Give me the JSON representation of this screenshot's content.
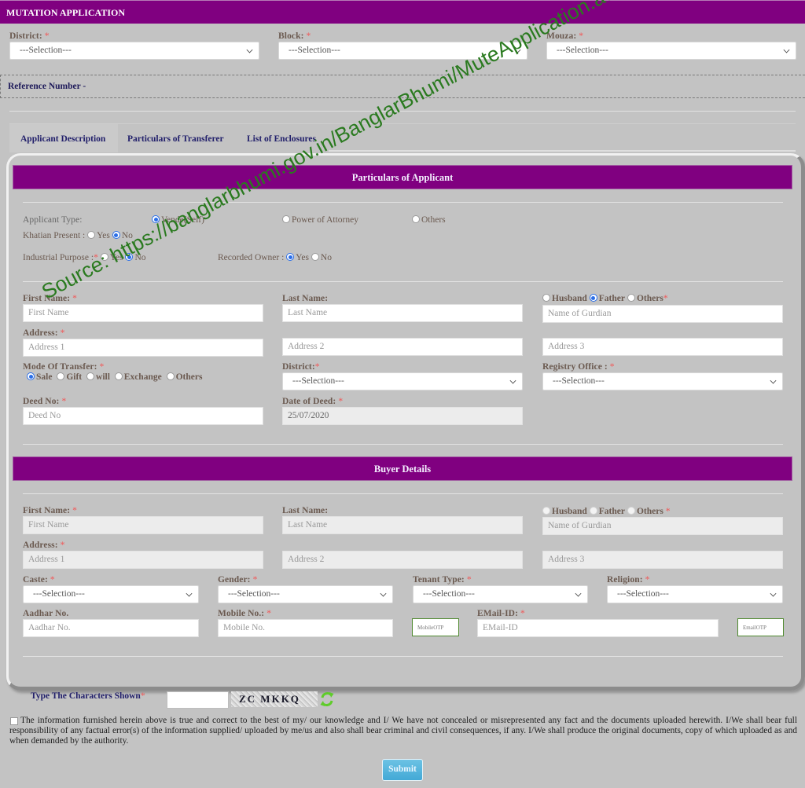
{
  "header": {
    "title": "MUTATION APPLICATION"
  },
  "location": {
    "district": {
      "label": "District:",
      "value": "---Selection---"
    },
    "block": {
      "label": "Block:",
      "value": "---Selection---"
    },
    "mouza": {
      "label": "Mouza:",
      "value": "---Selection---"
    }
  },
  "reference": {
    "label": "Reference Number -"
  },
  "tabs": [
    {
      "label": "Applicant Description",
      "active": true
    },
    {
      "label": "Particulars of Transferer",
      "active": false
    },
    {
      "label": "List of Enclosures",
      "active": false
    }
  ],
  "applicant": {
    "section_title": "Particulars of Applicant",
    "applicant_type": {
      "label": "Applicant Type:",
      "options": [
        "Vende(Self)",
        "Power of Attorney",
        "Others"
      ],
      "selected": "Vende(Self)"
    },
    "khatian_present": {
      "label": "Khatian Present :",
      "options": [
        "Yes",
        "No"
      ],
      "selected": "No"
    },
    "industrial_purpose": {
      "label": "Industrial Purpose :",
      "options": [
        "Yes",
        "No"
      ],
      "selected": "No"
    },
    "recorded_owner": {
      "label": "Recorded Owner :",
      "options": [
        "Yes",
        "No"
      ],
      "selected": "Yes"
    },
    "first_name": {
      "label": "First Name:",
      "placeholder": "First Name"
    },
    "last_name": {
      "label": "Last Name:",
      "placeholder": "Last Name"
    },
    "guardian_relation": {
      "options": [
        "Husband",
        "Father",
        "Others"
      ],
      "selected": "Father"
    },
    "guardian_name": {
      "placeholder": "Name of Gurdian"
    },
    "address": {
      "label": "Address:",
      "placeholders": [
        "Address 1",
        "Address 2",
        "Address 3"
      ]
    },
    "mode_of_transfer": {
      "label": "Mode Of Transfer:",
      "options": [
        "Sale",
        "Gift",
        "will",
        "Exchange",
        "Others"
      ],
      "selected": "Sale"
    },
    "district": {
      "label": "District:",
      "value": "---Selection---"
    },
    "registry_office": {
      "label": "Registry Office :",
      "value": "---Selection---"
    },
    "deed_no": {
      "label": "Deed No:",
      "placeholder": "Deed No"
    },
    "date_of_deed": {
      "label": "Date of Deed:",
      "value": "25/07/2020"
    }
  },
  "buyer": {
    "section_title": "Buyer Details",
    "first_name": {
      "label": "First Name:",
      "placeholder": "First Name"
    },
    "last_name": {
      "label": "Last Name:",
      "placeholder": "Last Name"
    },
    "guardian_relation": {
      "options": [
        "Husband",
        "Father",
        "Others"
      ],
      "selected": null
    },
    "guardian_name": {
      "placeholder": "Name of Gurdian"
    },
    "address": {
      "label": "Address:",
      "placeholders": [
        "Address 1",
        "Address 2",
        "Address 3"
      ]
    },
    "caste": {
      "label": "Caste:",
      "value": "---Selection---"
    },
    "gender": {
      "label": "Gender:",
      "value": "---Selection---"
    },
    "tenant_type": {
      "label": "Tenant Type:",
      "value": "---Selection---"
    },
    "religion": {
      "label": "Religion:",
      "value": "---Selection---"
    },
    "aadhar": {
      "label": "Aadhar No.",
      "placeholder": "Aadhar No."
    },
    "mobile": {
      "label": "Mobile No.:",
      "placeholder": "Mobile No."
    },
    "mobile_otp": {
      "placeholder": "MobileOTP"
    },
    "email": {
      "label": "EMail-ID:",
      "placeholder": "EMail-ID"
    },
    "email_otp": {
      "placeholder": "EmailOTP"
    }
  },
  "captcha": {
    "label": "Type The Characters Shown",
    "code": "ZC MKKQ"
  },
  "declaration": {
    "text": "The information furnished herein above is true and correct to the best of my/ our knowledge and I/ We have not concealed or misrepresented any fact and the documents uploaded herewith. I/We shall bear full responsibility of any factual error(s) of the information supplied/ uploaded by me/us and also shall bear criminal and civil consequences, if any. I/We shall produce the original documents, copy of which uploaded as and when demanded by the authority.",
    "checked": false
  },
  "submit": {
    "label": "Submit"
  },
  "required_mark": "*",
  "watermark": "Source: https://banglarbhumi.gov.in/BanglarBhumi/MuteApplication.action",
  "colors": {
    "header_purple": "#800080",
    "background": "#c3c3c3",
    "tab_text": "#22206b",
    "radio_selected": "#2a6ee8",
    "otp_border": "#4f8a2f",
    "submit_blue": "#43a9d6",
    "watermark_green": "#2a7a1f"
  }
}
